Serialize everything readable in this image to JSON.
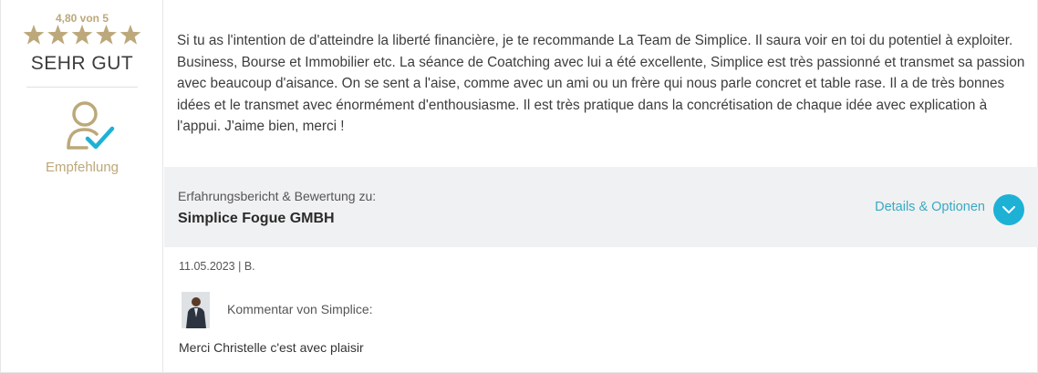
{
  "rating": {
    "score_text": "4,80 von 5",
    "stars_filled": 5,
    "stars_total": 5,
    "word": "SEHR GUT",
    "recommendation": "Empfehlung"
  },
  "review": {
    "text": "Si tu as l'intention de d'atteindre la liberté financière, je te recommande La Team de Simplice. Il saura voir en toi du potentiel à exploiter. Business, Bourse et Immobilier etc. La séance de Coatching avec lui a été excellente, Simplice est très passionné et transmet sa passion avec beaucoup d'aisance. On se sent a l'aise, comme avec un ami ou un frère qui nous parle concret et table rase. Il a de très bonnes idées et le transmet avec énormément d'enthousiasme. Il est très pratique dans la concrétisation de chaque idée avec explication à l'appui. J'aime bien, merci !"
  },
  "company_bar": {
    "label": "Erfahrungsbericht & Bewertung zu:",
    "company": "Simplice Fogue GMBH",
    "details_label": "Details & Optionen"
  },
  "meta": {
    "date_author": "11.05.2023 | B."
  },
  "comment": {
    "heading": "Kommentar von Simplice:",
    "text": "Merci Christelle c'est avec plaisir"
  },
  "colors": {
    "gold": "#bca87a",
    "accent": "#1eb1d6",
    "link": "#3aa9c3",
    "bar_bg": "#f0f1f2"
  },
  "icons": [
    "star-icon",
    "user-check-icon",
    "chevron-down-icon",
    "avatar-photo"
  ]
}
